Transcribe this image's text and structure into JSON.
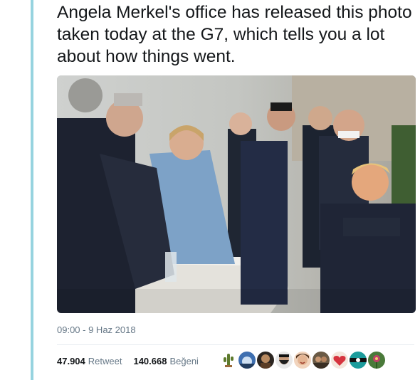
{
  "tweet": {
    "text": "Angela Merkel's office has released this photo taken today at the G7, which tells you a lot about how things went.",
    "timestamp": "09:00 - 9 Haz 2018"
  },
  "stats": {
    "retweets_count": "47.904",
    "retweets_label": "Retweet",
    "likes_count": "140.668",
    "likes_label": "Beğeni"
  },
  "liker_avatars": [
    "avatar-cactus-icon",
    "avatar-blue-sky",
    "avatar-dark-portrait",
    "avatar-bearded-face",
    "avatar-smiling-woman",
    "avatar-group-photo",
    "avatar-red-heart",
    "avatar-teal-swirl",
    "avatar-flower"
  ],
  "colors": {
    "text_primary": "#14171a",
    "text_secondary": "#657786",
    "thread_line": "#96d3df"
  }
}
